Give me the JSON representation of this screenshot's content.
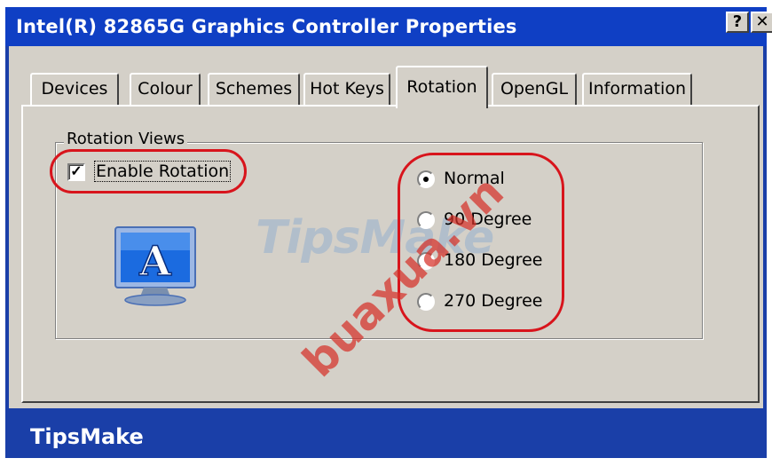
{
  "window": {
    "title": "Intel(R) 82865G Graphics Controller Properties",
    "help_label": "?",
    "close_label": "✕"
  },
  "tabs": [
    {
      "label": "Devices"
    },
    {
      "label": "Colour"
    },
    {
      "label": "Schemes"
    },
    {
      "label": "Hot Keys"
    },
    {
      "label": "Rotation",
      "active": true
    },
    {
      "label": "OpenGL"
    },
    {
      "label": "Information"
    }
  ],
  "rotation": {
    "group_label": "Rotation Views",
    "enable_label": "Enable Rotation",
    "enable_checked": true,
    "options": [
      {
        "label": "Normal",
        "selected": true
      },
      {
        "label": "90 Degree",
        "selected": false
      },
      {
        "label": "180 Degree",
        "selected": false
      },
      {
        "label": "270 Degree",
        "selected": false
      }
    ]
  },
  "icons": {
    "monitor": "monitor-icon",
    "checkmark": "✓"
  },
  "watermarks": {
    "tipsmake": "TipsMake",
    "buaxua": "buaxua.vn"
  },
  "footer": {
    "brand": "TipsMake"
  },
  "colors": {
    "titlebar": "#0f3fc4",
    "frame": "#1a3fa8",
    "dialog": "#d4d0c8",
    "highlight_oval": "#d8141c"
  }
}
